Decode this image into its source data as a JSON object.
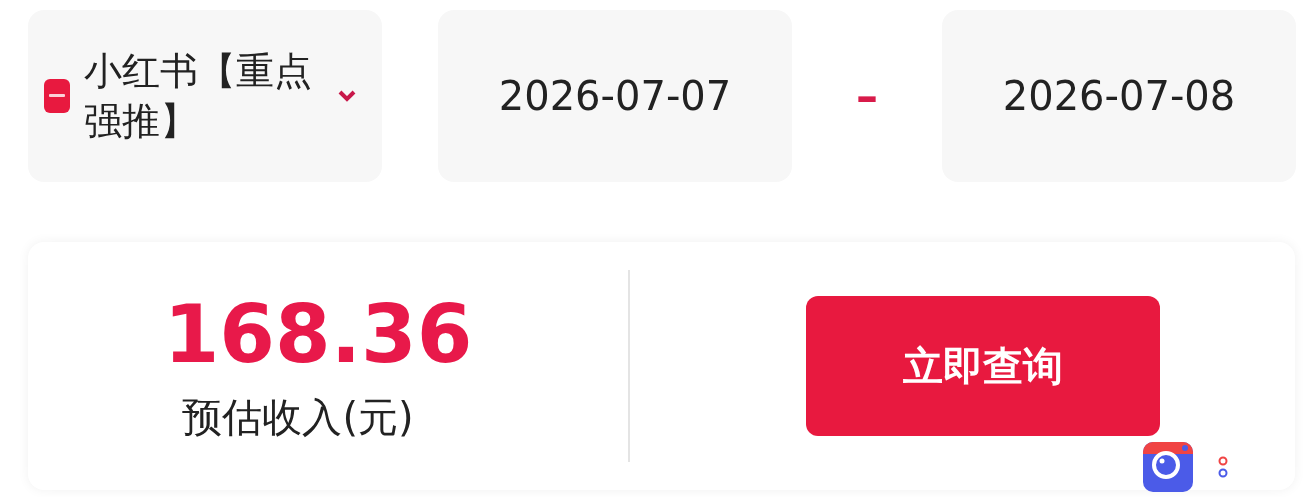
{
  "filter": {
    "platform": {
      "label": "小红书【重点强推】"
    },
    "start_date": "2026-07-07",
    "separator": "–",
    "end_date": "2026-07-08"
  },
  "summary": {
    "amount": "168.36",
    "amount_label": "预估收入(元)",
    "query_button": "立即查询"
  }
}
